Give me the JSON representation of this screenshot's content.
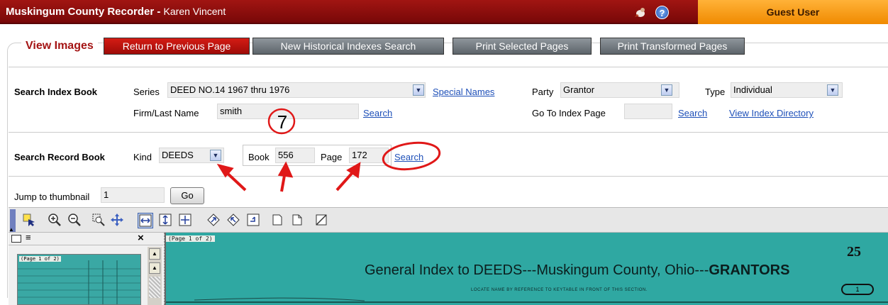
{
  "header": {
    "title": "Muskingum County Recorder",
    "separator": " - ",
    "user_name": "Karen Vincent",
    "help_label": "?",
    "guest_label": "Guest User"
  },
  "nav": {
    "view_title": "View Images",
    "buttons": [
      "Return to Previous Page",
      "New Historical Indexes Search",
      "Print Selected Pages",
      "Print Transformed Pages"
    ]
  },
  "index_search": {
    "section_label": "Search Index Book",
    "series_label": "Series",
    "series_value": "DEED NO.14 1967 thru 1976",
    "special_names_link": "Special Names",
    "party_label": "Party",
    "party_value": "Grantor",
    "type_label": "Type",
    "type_value": "Individual",
    "firm_label": "Firm/Last Name",
    "firm_value": "smith",
    "search_link": "Search",
    "goto_label": "Go To Index Page",
    "goto_value": "",
    "goto_search_link": "Search",
    "directory_link": "View Index Directory"
  },
  "record_search": {
    "section_label": "Search Record Book",
    "kind_label": "Kind",
    "kind_value": "DEEDS",
    "book_label": "Book",
    "book_value": "556",
    "page_label": "Page",
    "page_value": "172",
    "search_link": "Search"
  },
  "thumbnail": {
    "jump_label": "Jump to thumbnail",
    "jump_value": "1",
    "go_label": "Go",
    "close_label": "×",
    "page_tab": "(Page 1 of 2)"
  },
  "viewer": {
    "page_tab": "(Page 1 of 2)",
    "doc_heading_prefix": "General Index to DEEDS---Muskingum County, Ohio---",
    "doc_heading_bold": "GRANTORS",
    "doc_number": "25",
    "doc_subtitle": "LOCATE NAME BY REFERENCE TO KEYTABLE IN FRONT OF THIS SECTION.",
    "doc_oval": "1"
  },
  "annotation": {
    "step_number": "7"
  },
  "colors": {
    "header_red": "#8e0f0c",
    "guest_orange": "#f5a020",
    "link_blue": "#1d4fb8",
    "viewer_teal": "#2fa8a2",
    "annotation_red": "#e01818"
  }
}
